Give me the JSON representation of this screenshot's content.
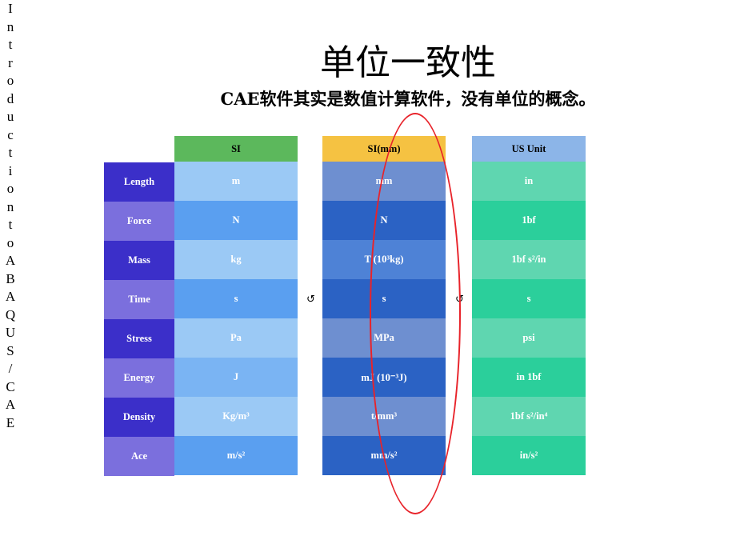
{
  "side_title": "Introduction to ABAQUS / CAE",
  "title": "单位一致性",
  "subtitle": "CAE软件其实是数值计算软件，没有单位的概念。",
  "quantities": [
    "Length",
    "Force",
    "Mass",
    "Time",
    "Stress",
    "Energy",
    "Density",
    "Ace"
  ],
  "tables": [
    {
      "header": "SI",
      "header_bg": "#5cb85c",
      "values": [
        "m",
        "N",
        "kg",
        "s",
        "Pa",
        "J",
        "Kg/m³",
        "m/s²"
      ]
    },
    {
      "header": "SI(mm)",
      "header_bg": "#f5c242",
      "values": [
        "mm",
        "N",
        "T (10³kg)",
        "s",
        "MPa",
        "mJ (10⁻³J)",
        "t/mm³",
        "mm/s²"
      ]
    },
    {
      "header": "US Unit",
      "header_bg": "#8cb5e8",
      "values": [
        "in",
        "1bf",
        "1bf s²/in",
        "s",
        "psi",
        "in 1bf",
        "1bf s²/in⁴",
        "in/s²"
      ]
    }
  ],
  "arrows": [
    "↺",
    "↺"
  ],
  "annotation": {
    "shape": "ellipse",
    "color": "#e8232a"
  }
}
